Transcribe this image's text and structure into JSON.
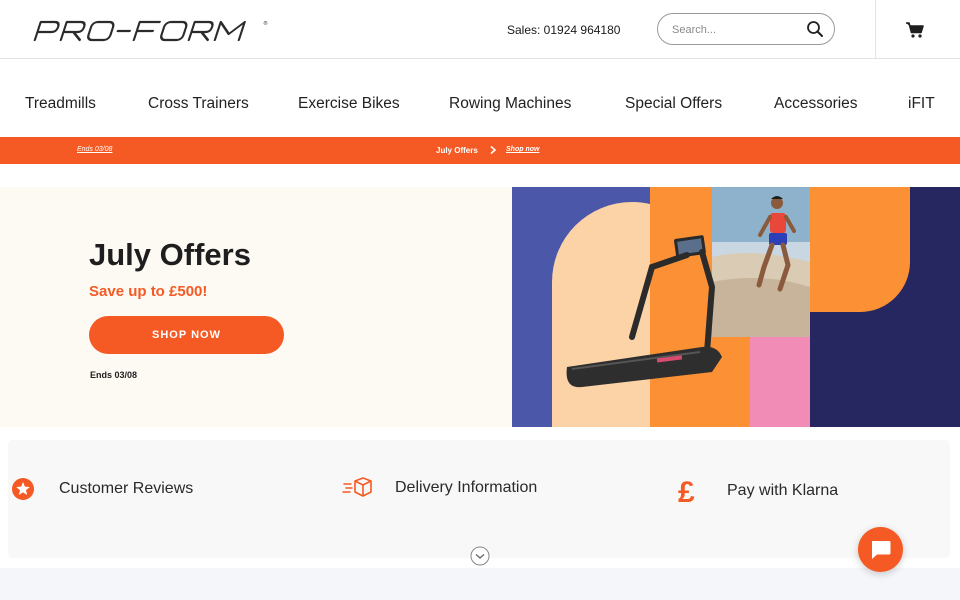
{
  "header": {
    "brand": "PRO-FORM",
    "sales": "Sales: 01924 964180",
    "search_placeholder": "Search...",
    "search_icon": "search-icon",
    "cart_icon": "cart-icon"
  },
  "nav": {
    "items": [
      {
        "label": "Treadmills"
      },
      {
        "label": "Cross Trainers"
      },
      {
        "label": "Exercise Bikes"
      },
      {
        "label": "Rowing Machines"
      },
      {
        "label": "Special Offers"
      },
      {
        "label": "Accessories"
      },
      {
        "label": "iFIT"
      }
    ]
  },
  "promo": {
    "ends": "Ends 03/08",
    "title": "July Offers",
    "link": "Shop now"
  },
  "hero": {
    "title": "July Offers",
    "subtitle": "Save up to £500!",
    "button": "SHOP NOW",
    "ends": "Ends 03/08"
  },
  "features": [
    {
      "label": "Customer Reviews",
      "icon": "star-badge-icon"
    },
    {
      "label": "Delivery Information",
      "icon": "delivery-box-icon"
    },
    {
      "label": "Pay with Klarna",
      "icon": "pound-icon"
    }
  ],
  "colors": {
    "accent": "#f55a24",
    "navy": "#262660",
    "blue": "#4b57a8",
    "peach": "#fcd3a6",
    "orange": "#fb9034",
    "pink": "#f18cb7"
  }
}
